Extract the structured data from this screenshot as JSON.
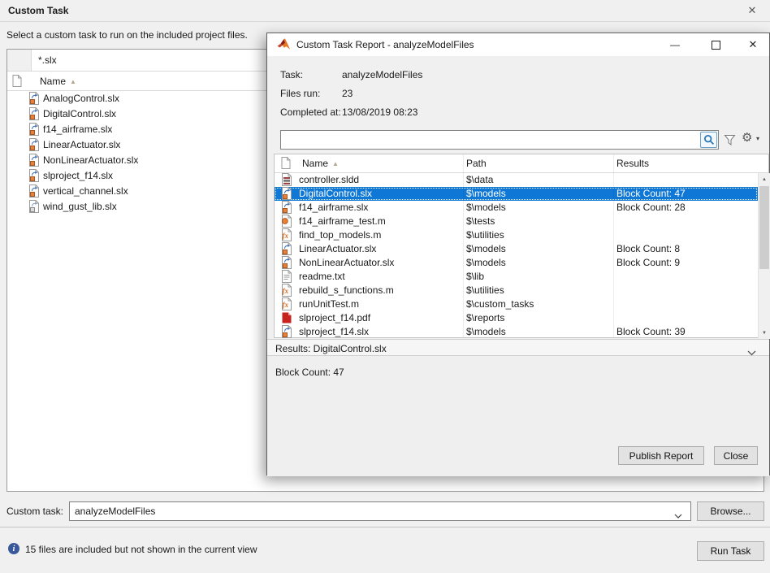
{
  "window": {
    "title": "Custom Task",
    "close_icon": "✕",
    "instruction": "Select a custom task to run on the included project files."
  },
  "file_panel": {
    "filter_value": "*.slx",
    "name_header": "Name",
    "sort_icon": "▲",
    "files": [
      {
        "icon": "simulink-model",
        "name": "AnalogControl.slx"
      },
      {
        "icon": "simulink-model",
        "name": "DigitalControl.slx"
      },
      {
        "icon": "simulink-model",
        "name": "f14_airframe.slx"
      },
      {
        "icon": "simulink-model",
        "name": "LinearActuator.slx"
      },
      {
        "icon": "simulink-model",
        "name": "NonLinearActuator.slx"
      },
      {
        "icon": "simulink-model",
        "name": "slproject_f14.slx"
      },
      {
        "icon": "simulink-model",
        "name": "vertical_channel.slx"
      },
      {
        "icon": "simulink-library",
        "name": "wind_gust_lib.slx"
      }
    ]
  },
  "dialog": {
    "title": "Custom Task Report - analyzeModelFiles",
    "window_controls": {
      "minimize": "—",
      "close": "✕"
    },
    "info_rows": [
      {
        "label": "Task:",
        "value": "analyzeModelFiles"
      },
      {
        "label": "Files run:",
        "value": "23"
      },
      {
        "label": "Completed at:",
        "value": "13/08/2019 08:23"
      }
    ],
    "search": {
      "value": "",
      "placeholder": ""
    },
    "table": {
      "columns": [
        "Name",
        "Path",
        "Results"
      ],
      "sort_icon": "▲",
      "rows": [
        {
          "icon": "data-dictionary",
          "name": "controller.sldd",
          "path": "$\\data",
          "result": "",
          "selected": false
        },
        {
          "icon": "simulink-model",
          "name": "DigitalControl.slx",
          "path": "$\\models",
          "result": "Block Count: 47",
          "selected": true
        },
        {
          "icon": "simulink-model",
          "name": "f14_airframe.slx",
          "path": "$\\models",
          "result": "Block Count: 28",
          "selected": false
        },
        {
          "icon": "matlab-test",
          "name": "f14_airframe_test.m",
          "path": "$\\tests",
          "result": "",
          "selected": false
        },
        {
          "icon": "matlab-function",
          "name": "find_top_models.m",
          "path": "$\\utilities",
          "result": "",
          "selected": false
        },
        {
          "icon": "simulink-model",
          "name": "LinearActuator.slx",
          "path": "$\\models",
          "result": "Block Count: 8",
          "selected": false
        },
        {
          "icon": "simulink-model",
          "name": "NonLinearActuator.slx",
          "path": "$\\models",
          "result": "Block Count: 9",
          "selected": false
        },
        {
          "icon": "text-file",
          "name": "readme.txt",
          "path": "$\\lib",
          "result": "",
          "selected": false
        },
        {
          "icon": "matlab-function",
          "name": "rebuild_s_functions.m",
          "path": "$\\utilities",
          "result": "",
          "selected": false
        },
        {
          "icon": "matlab-function",
          "name": "runUnitTest.m",
          "path": "$\\custom_tasks",
          "result": "",
          "selected": false
        },
        {
          "icon": "pdf-file",
          "name": "slproject_f14.pdf",
          "path": "$\\reports",
          "result": "",
          "selected": false
        },
        {
          "icon": "simulink-model",
          "name": "slproject_f14.slx",
          "path": "$\\models",
          "result": "Block Count: 39",
          "selected": false
        }
      ]
    },
    "results_section": {
      "header": "Results: DigitalControl.slx",
      "content": "Block Count: 47"
    },
    "buttons": {
      "publish": "Publish Report",
      "close": "Close"
    }
  },
  "footer": {
    "custom_task_label": "Custom task:",
    "custom_task_value": "analyzeModelFiles",
    "browse_label": "Browse...",
    "info_text": "15 files are included but not shown in the current view",
    "run_task_label": "Run Task"
  },
  "colors": {
    "selection_blue": "#0f78d6",
    "window_bg": "#f0f0f0",
    "button_bg": "#e2e2e2",
    "info_icon_blue": "#39599b"
  }
}
